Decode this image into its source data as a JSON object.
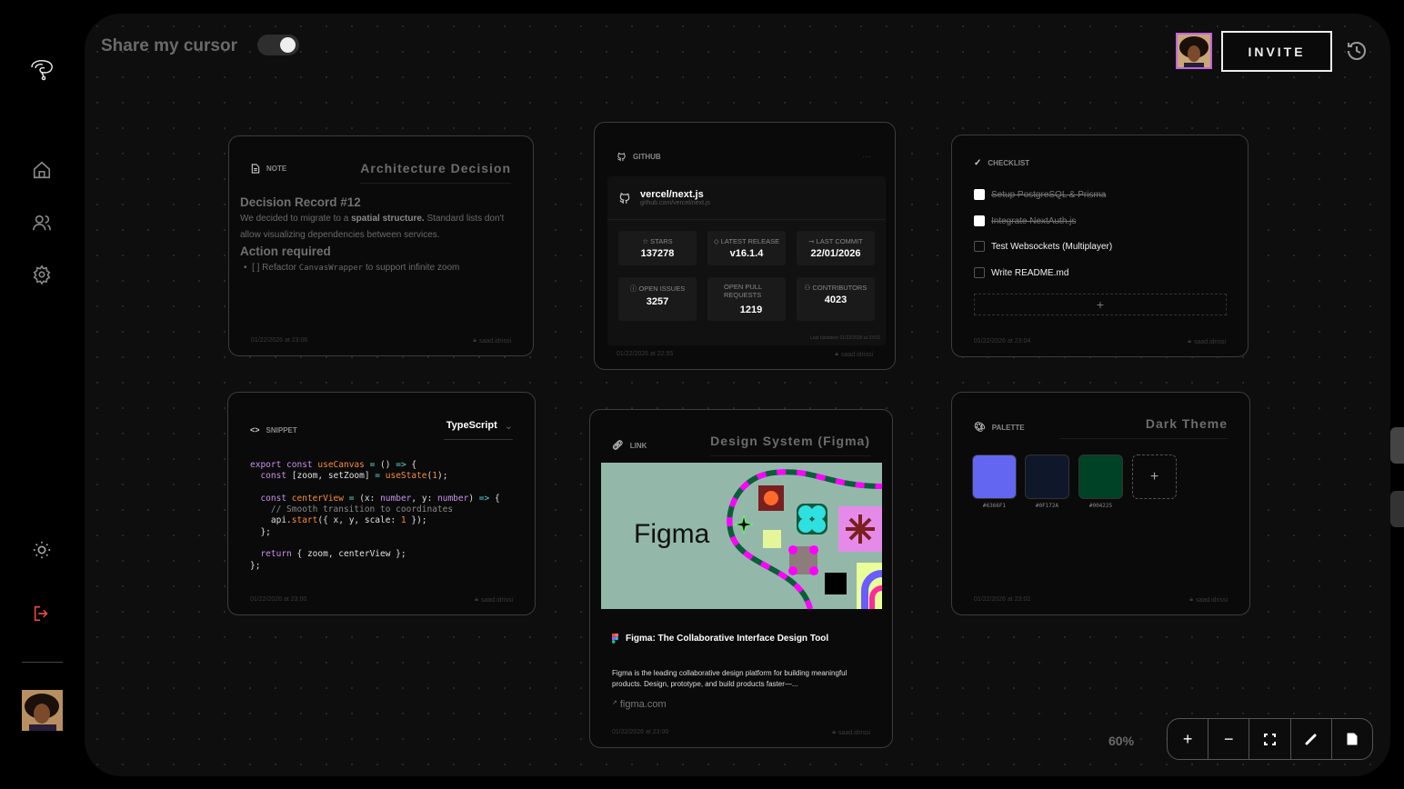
{
  "header": {
    "share_cursor_label": "Share my cursor",
    "share_cursor_on": true,
    "invite_label": "INVITE"
  },
  "sidebar": {
    "items": [
      "logo-icon",
      "home-icon",
      "users-icon",
      "settings-icon",
      "theme-icon",
      "logout-icon"
    ]
  },
  "note": {
    "type": "NOTE",
    "title": "Architecture Decision",
    "heading": "Decision Record #12",
    "text_pre": "We decided to migrate to a ",
    "text_bold": "spatial structure.",
    "text_post": " Standard lists don't allow visualizing dependencies between services.",
    "subheading": "Action required",
    "bullet_pre": "[ ] Refactor ",
    "bullet_code": "CanvasWrapper",
    "bullet_post": " to support infinite zoom",
    "timestamp": "01/22/2026 at 23:06",
    "author": "saad.idrissi"
  },
  "github": {
    "type": "GITHUB",
    "repo": "vercel/next.js",
    "url": "github.com/vercel/next.js",
    "stats": [
      {
        "label": "STARS",
        "value": "137278"
      },
      {
        "label": "LATEST RELEASE",
        "value": "v16.1.4"
      },
      {
        "label": "LAST COMMIT",
        "value": "22/01/2026"
      },
      {
        "label": "OPEN ISSUES",
        "value": "3257"
      },
      {
        "label": "OPEN PULL REQUESTS",
        "value": "1219"
      },
      {
        "label": "CONTRIBUTORS",
        "value": "4023"
      }
    ],
    "last_updated": "Last Updated: 01/22/2026 at 23:02",
    "timestamp": "01/22/2026 at 22:55",
    "author": "saad.idrissi"
  },
  "checklist": {
    "type": "CHECKLIST",
    "items": [
      {
        "label": "Setup PostgreSQL & Prisma",
        "done": true
      },
      {
        "label": "Integrate NextAuth.js",
        "done": true
      },
      {
        "label": "Test Websockets (Multiplayer)",
        "done": false
      },
      {
        "label": "Write README.md",
        "done": false
      }
    ],
    "add_label": "+",
    "timestamp": "01/22/2026 at 23:04",
    "author": "saad.idrissi"
  },
  "snippet": {
    "type": "SNIPPET",
    "language": "TypeScript",
    "timestamp": "01/22/2026 at 23:00",
    "author": "saad.idrissi"
  },
  "link": {
    "type": "LINK",
    "title": "Design System (Figma)",
    "image_text": "Figma",
    "page_title": "Figma: The Collaborative Interface Design Tool",
    "description": "Figma is the leading collaborative design platform for building meaningful products. Design, prototype, and build products faster—...",
    "domain": "figma.com",
    "timestamp": "01/22/2026 at 23:00",
    "author": "saad.idrissi"
  },
  "palette": {
    "type": "PALETTE",
    "title": "Dark Theme",
    "colors": [
      "#6366F1",
      "#0F172A",
      "#004225"
    ],
    "add_label": "+",
    "timestamp": "01/22/2026 at 23:02",
    "author": "saad.idrissi"
  },
  "controls": {
    "zoom": "60%",
    "tools": [
      "zoom-in",
      "zoom-out",
      "fit-screen",
      "draw",
      "note"
    ]
  }
}
